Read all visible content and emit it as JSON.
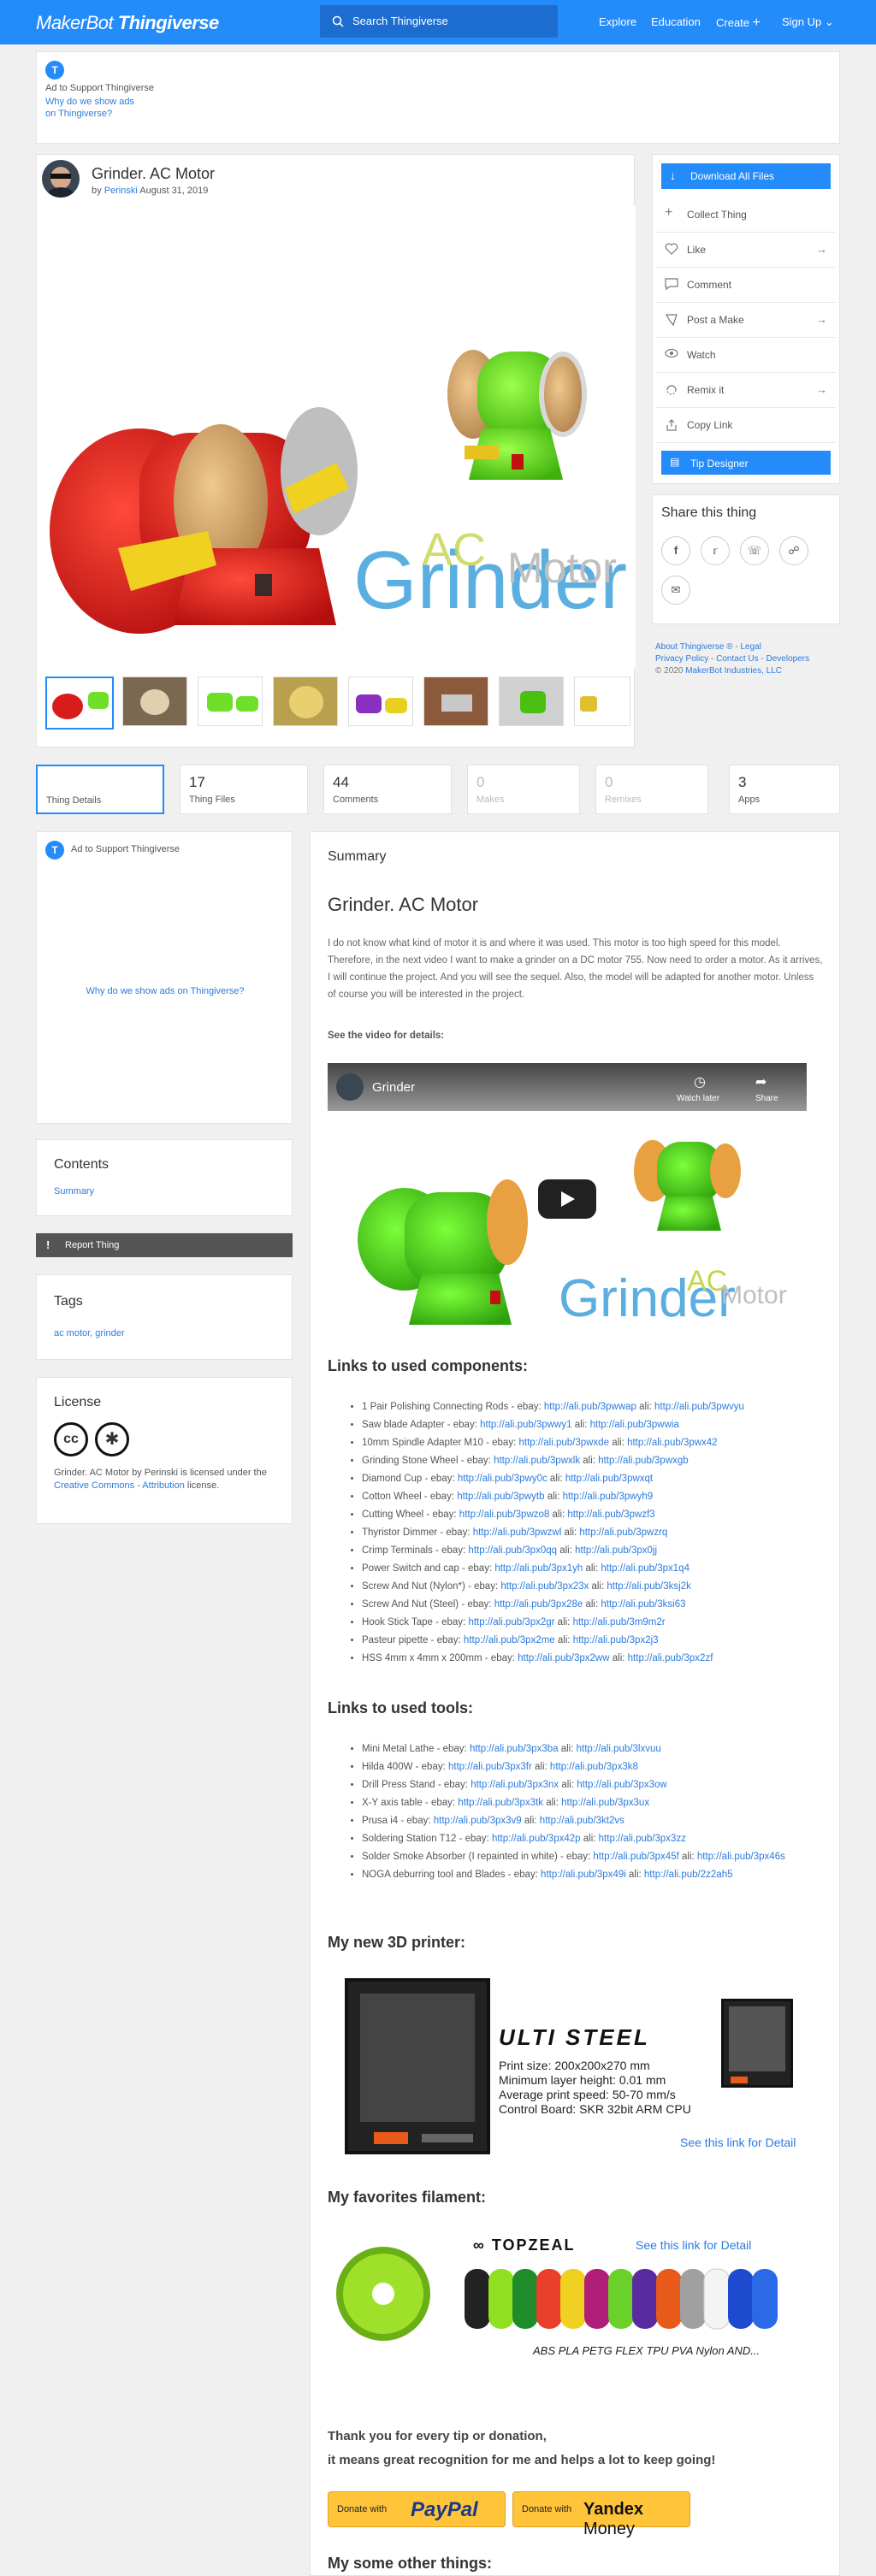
{
  "header": {
    "logo_main": "MakerBot",
    "logo_sub": "Thingiverse",
    "search_placeholder": "Search Thingiverse",
    "nav": [
      "Explore",
      "Education",
      "Create",
      "Sign Up"
    ]
  },
  "top_ad": {
    "label": "Ad to Support Thingiverse",
    "why_line1": "Why do we show ads",
    "why_line2": "on Thingiverse?"
  },
  "thing": {
    "title": "Grinder. AC Motor",
    "by": "by",
    "author": "Perinski",
    "date": "August 31, 2019",
    "hero_text_main": "Grinder",
    "hero_text_ac": "AC",
    "hero_text_motor": "Motor"
  },
  "actions": {
    "download_all": "Download All Files",
    "items": [
      {
        "label": "Collect Thing",
        "icon": "plus-icon",
        "arrow": false
      },
      {
        "label": "Like",
        "icon": "heart-icon",
        "arrow": true
      },
      {
        "label": "Comment",
        "icon": "comment-icon",
        "arrow": false
      },
      {
        "label": "Post a Make",
        "icon": "make-icon",
        "arrow": true
      },
      {
        "label": "Watch",
        "icon": "eye-icon",
        "arrow": false
      },
      {
        "label": "Remix it",
        "icon": "remix-icon",
        "arrow": true
      },
      {
        "label": "Copy Link",
        "icon": "share-icon",
        "arrow": false
      }
    ],
    "tip_designer": "Tip Designer"
  },
  "share": {
    "title": "Share this thing",
    "icons": [
      "facebook-icon",
      "twitter-icon",
      "whatsapp-icon",
      "link-icon",
      "email-icon"
    ]
  },
  "footer_links": {
    "line1a": "About Thingiverse ®",
    "line1b": "Legal",
    "line2a": "Privacy Policy",
    "line2b": "Contact Us",
    "line2c": "Developers",
    "copyright": "© 2020",
    "company": "MakerBot Industries, LLC"
  },
  "stats": [
    {
      "num": "",
      "label": "Thing Details",
      "dim": false
    },
    {
      "num": "17",
      "label": "Thing Files",
      "dim": false
    },
    {
      "num": "44",
      "label": "Comments",
      "dim": false
    },
    {
      "num": "0",
      "label": "Makes",
      "dim": true
    },
    {
      "num": "0",
      "label": "Remixes",
      "dim": true
    },
    {
      "num": "3",
      "label": "Apps",
      "dim": false
    }
  ],
  "side_ad": {
    "label": "Ad to Support Thingiverse",
    "why": "Why do we show ads on Thingiverse?"
  },
  "contents": {
    "title": "Contents",
    "link": "Summary"
  },
  "report": "Report Thing",
  "tags": {
    "title": "Tags",
    "list": "ac motor, grinder"
  },
  "license": {
    "title": "License",
    "text_pre": "Grinder. AC Motor by Perinski is licensed under the",
    "link": "Creative Commons - Attribution",
    "text_post": "license."
  },
  "summary": {
    "section": "Summary",
    "title": "Grinder. AC Motor",
    "para": "I do not know what kind of motor it is and where it was used. This motor is too high speed for this model. Therefore, in the next video I want to make a grinder on a DC motor 755. Now need to order a motor. As it arrives, I will continue the project. And you will see the sequel. Also, the model will be adapted for another motor. Unless of course you will be interested in the project.",
    "video_label": "See the video for details:",
    "video_title": "Grinder",
    "video_watch_later": "Watch later",
    "video_share": "Share"
  },
  "components": {
    "title": "Links to used components:",
    "items": [
      {
        "name": "1 Pair Polishing Connecting Rods - ebay:",
        "a": "http://ali.pub/3pwwap",
        "b": "http://ali.pub/3pwvyu"
      },
      {
        "name": "Saw blade Adapter - ebay:",
        "a": "http://ali.pub/3pwwy1",
        "b": "http://ali.pub/3pwwia"
      },
      {
        "name": "10mm Spindle Adapter M10 - ebay:",
        "a": "http://ali.pub/3pwxde",
        "b": "http://ali.pub/3pwx42"
      },
      {
        "name": "Grinding Stone Wheel - ebay:",
        "a": "http://ali.pub/3pwxlk",
        "b": "http://ali.pub/3pwxgb"
      },
      {
        "name": "Diamond Cup - ebay:",
        "a": "http://ali.pub/3pwy0c",
        "b": "http://ali.pub/3pwxqt"
      },
      {
        "name": "Cotton Wheel - ebay:",
        "a": "http://ali.pub/3pwytb",
        "b": "http://ali.pub/3pwyh9"
      },
      {
        "name": "Cutting Wheel - ebay:",
        "a": "http://ali.pub/3pwzo8",
        "b": "http://ali.pub/3pwzf3"
      },
      {
        "name": "Thyristor Dimmer - ebay:",
        "a": "http://ali.pub/3pwzwl",
        "b": "http://ali.pub/3pwzrq"
      },
      {
        "name": "Crimp Terminals - ebay:",
        "a": "http://ali.pub/3px0qq",
        "b": "http://ali.pub/3px0jj"
      },
      {
        "name": "Power Switch and cap - ebay:",
        "a": "http://ali.pub/3px1yh",
        "b": "http://ali.pub/3px1q4"
      },
      {
        "name": "Screw And Nut (Nylon*) - ebay:",
        "a": "http://ali.pub/3px23x",
        "b": "http://ali.pub/3ksj2k"
      },
      {
        "name": "Screw And Nut (Steel) - ebay:",
        "a": "http://ali.pub/3px28e",
        "b": "http://ali.pub/3ksi63"
      },
      {
        "name": "Hook Stick Tape - ebay:",
        "a": "http://ali.pub/3px2gr",
        "b": "http://ali.pub/3m9m2r"
      },
      {
        "name": "Pasteur pipette - ebay:",
        "a": "http://ali.pub/3px2me",
        "b": "http://ali.pub/3px2j3"
      },
      {
        "name": "HSS 4mm x 4mm x 200mm - ebay:",
        "a": "http://ali.pub/3px2ww",
        "b": "http://ali.pub/3px2zf"
      }
    ]
  },
  "tools": {
    "title": "Links to used tools:",
    "items": [
      {
        "name": "Mini Metal Lathe - ebay:",
        "a": "http://ali.pub/3px3ba",
        "b": "http://ali.pub/3lxvuu"
      },
      {
        "name": "Hilda 400W - ebay:",
        "a": "http://ali.pub/3px3fr",
        "b": "http://ali.pub/3px3k8"
      },
      {
        "name": "Drill Press Stand - ebay:",
        "a": "http://ali.pub/3px3nx",
        "b": "http://ali.pub/3px3ow"
      },
      {
        "name": "X-Y axis table - ebay:",
        "a": "http://ali.pub/3px3tk",
        "b": "http://ali.pub/3px3ux"
      },
      {
        "name": "Prusa i4 - ebay:",
        "a": "http://ali.pub/3px3v9",
        "b": "http://ali.pub/3kt2vs"
      },
      {
        "name": "Soldering Station T12 - ebay:",
        "a": "http://ali.pub/3px42p",
        "b": "http://ali.pub/3px3zz"
      },
      {
        "name": "Solder Smoke Absorber (I repainted in white) - ebay:",
        "a": "http://ali.pub/3px45f",
        "b": "http://ali.pub/3px46s"
      },
      {
        "name": "NOGA deburring tool and Blades - ebay:",
        "a": "http://ali.pub/3px49i",
        "b": "http://ali.pub/2z2ah5"
      }
    ],
    "ali_label": "ali:"
  },
  "printer": {
    "title": "My new 3D printer:",
    "brand": "ULTI STEEL",
    "specs": [
      "Print size: 200x200x270 mm",
      "Minimum layer height: 0.01 mm",
      "Average print speed: 50-70 mm/s",
      "Control Board: SKR 32bit ARM CPU"
    ],
    "link": "See this link for Detail"
  },
  "filament": {
    "title": "My favorites filament:",
    "brand": "TOPZEAL",
    "link": "See this link for Detail",
    "types": "ABS PLA PETG FLEX TPU PVA Nylon AND..."
  },
  "thanks": {
    "line1": "Thank you for every tip or donation,",
    "line2": "it means great recognition for me and helps a lot to keep going!"
  },
  "donate": {
    "paypal_pre": "Donate with",
    "paypal": "PayPal",
    "yandex_pre": "Donate with",
    "yandex": "Yandex",
    "yandex_money": "Money"
  },
  "more_title": "My some other things:",
  "colors": {
    "brand": "#248bfb",
    "link": "#2b7bdc",
    "cardbg": "#ffffff",
    "pagebg": "#f0f0f0"
  }
}
